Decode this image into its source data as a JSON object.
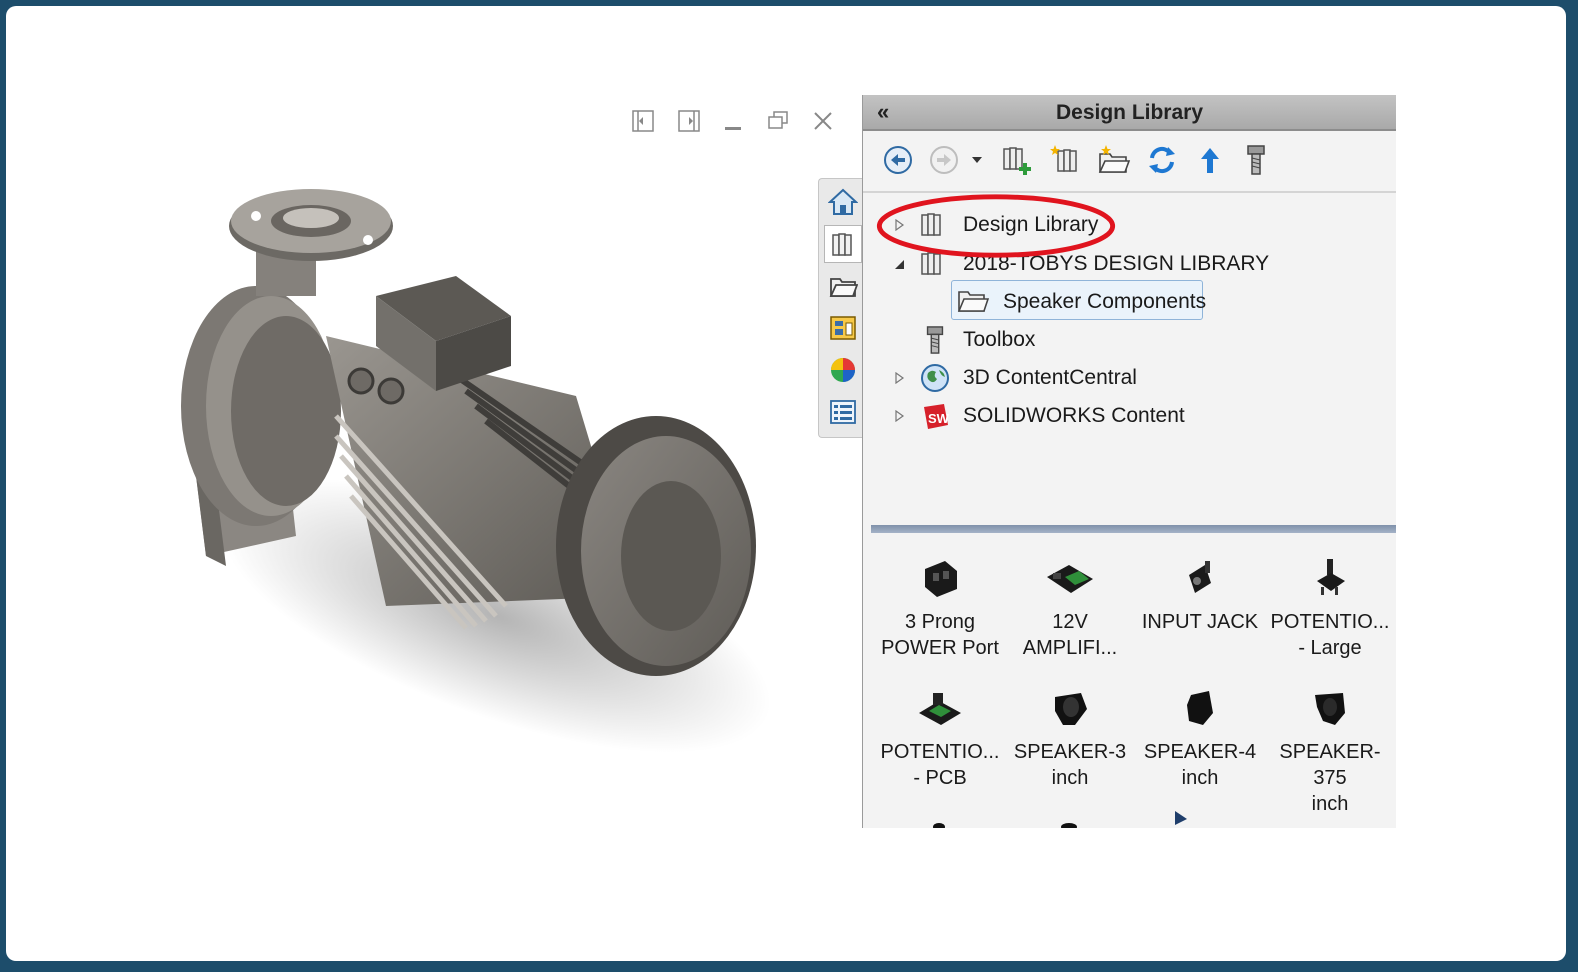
{
  "panel": {
    "title": "Design Library",
    "collapse_label": "«"
  },
  "toolbar": {
    "buttons": [
      "back-icon",
      "forward-icon",
      "dropdown-icon",
      "add-to-library-icon",
      "add-file-location-icon",
      "create-folder-icon",
      "refresh-icon",
      "up-one-level-icon",
      "toolbox-icon"
    ]
  },
  "tree": {
    "items": [
      {
        "label": "Design Library",
        "icon": "library-icon"
      },
      {
        "label": "2018-TOBYS DESIGN LIBRARY",
        "icon": "library-icon"
      },
      {
        "label": "Speaker Components",
        "icon": "folder-icon"
      },
      {
        "label": "Toolbox",
        "icon": "toolbox-icon"
      },
      {
        "label": "3D ContentCentral",
        "icon": "globe-icon"
      },
      {
        "label": "SOLIDWORKS Content",
        "icon": "solidworks-icon"
      }
    ]
  },
  "sidetabs": [
    "home-icon",
    "design-library-icon",
    "file-explorer-icon",
    "view-palette-icon",
    "appearances-icon",
    "custom-properties-icon"
  ],
  "components": [
    {
      "line1": "3 Prong",
      "line2": "POWER Port"
    },
    {
      "line1": "12V",
      "line2": "AMPLIFI..."
    },
    {
      "line1": "INPUT JACK",
      "line2": ""
    },
    {
      "line1": "POTENTIO...",
      "line2": "- Large"
    },
    {
      "line1": "POTENTIO...",
      "line2": "- PCB"
    },
    {
      "line1": "SPEAKER-3",
      "line2": "inch"
    },
    {
      "line1": "SPEAKER-4",
      "line2": "inch"
    },
    {
      "line1": "SPEAKER-375",
      "line2": "inch"
    }
  ],
  "colors": {
    "highlight_ellipse": "#e0141e",
    "selection_bg": "#eaf3fb",
    "splitter": "#8e9db3"
  }
}
